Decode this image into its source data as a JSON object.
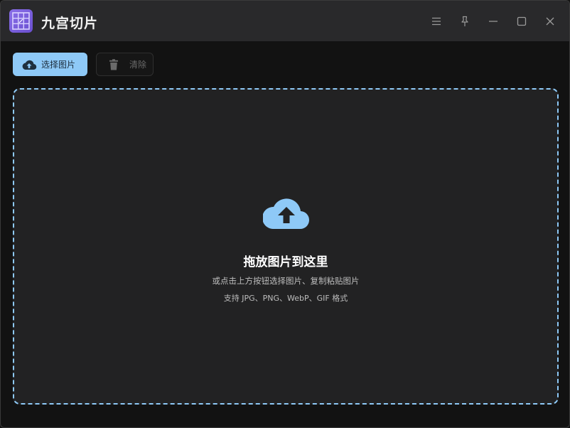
{
  "app": {
    "title": "九宫切片",
    "accent": "#8ec9f7",
    "icon": "grid-slice-icon"
  },
  "window_controls": {
    "menu": "menu-icon",
    "pin": "pin-icon",
    "minimize": "minimize-icon",
    "maximize": "maximize-icon",
    "close": "close-icon"
  },
  "toolbar": {
    "select_label": "选择图片",
    "select_icon": "cloud-upload-icon",
    "clear_label": "清除",
    "clear_icon": "trash-icon"
  },
  "dropzone": {
    "icon": "cloud-upload-icon",
    "title": "拖放图片到这里",
    "hint": "或点击上方按钮选择图片、复制粘贴图片",
    "formats": "支持 JPG、PNG、WebP、GIF 格式"
  }
}
